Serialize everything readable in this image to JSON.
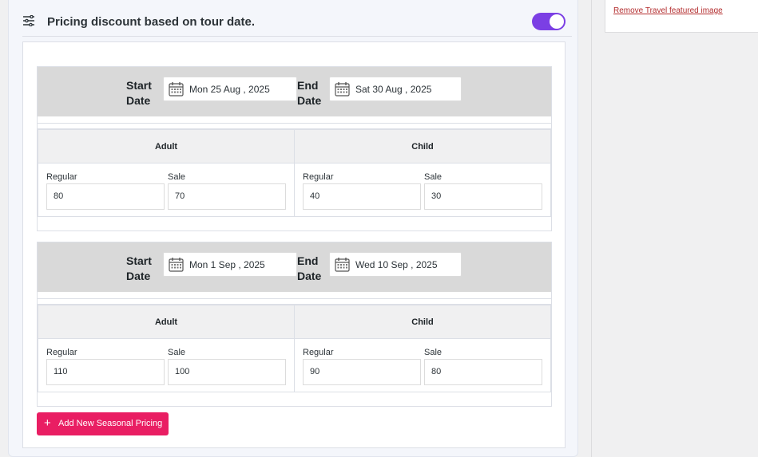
{
  "header": {
    "icon": "sliders-icon",
    "title": "Pricing discount based on tour date.",
    "toggle_on": true,
    "toggle_color": "#7b3fe4"
  },
  "start_label": "Start Date",
  "end_label": "End Date",
  "seasons": [
    {
      "start_date": "Mon 25 Aug , 2025",
      "end_date": "Sat 30 Aug , 2025",
      "adult": {
        "title": "Adult",
        "regular_label": "Regular",
        "sale_label": "Sale",
        "regular": "80",
        "sale": "70"
      },
      "child": {
        "title": "Child",
        "regular_label": "Regular",
        "sale_label": "Sale",
        "regular": "40",
        "sale": "30"
      }
    },
    {
      "start_date": "Mon 1 Sep , 2025",
      "end_date": "Wed 10 Sep , 2025",
      "adult": {
        "title": "Adult",
        "regular_label": "Regular",
        "sale_label": "Sale",
        "regular": "110",
        "sale": "100"
      },
      "child": {
        "title": "Child",
        "regular_label": "Regular",
        "sale_label": "Sale",
        "regular": "90",
        "sale": "80"
      }
    }
  ],
  "add_button": {
    "icon": "plus-icon",
    "label": "Add New Seasonal Pricing",
    "color": "#e91e63"
  },
  "sidebar": {
    "remove_link": "Remove Travel featured image"
  }
}
